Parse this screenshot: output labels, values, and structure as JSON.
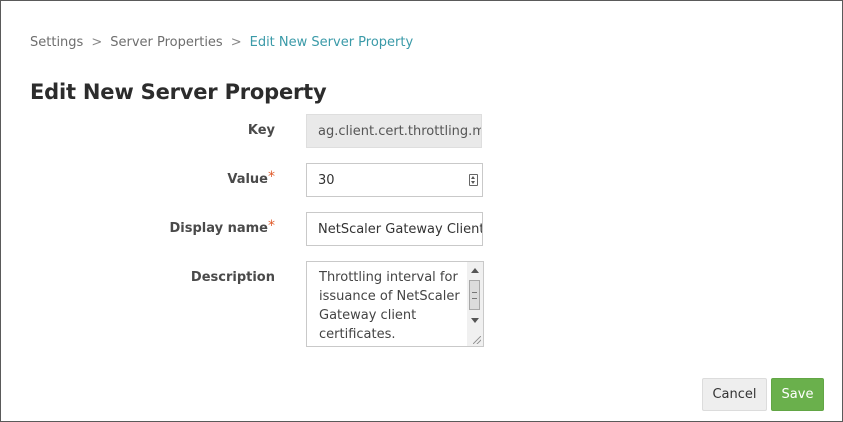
{
  "breadcrumb": {
    "items": [
      "Settings",
      "Server Properties",
      "Edit New Server Property"
    ],
    "separator": ">"
  },
  "page_title": "Edit New Server Property",
  "form": {
    "key": {
      "label": "Key",
      "value": "ag.client.cert.throttling.mi",
      "readonly": true
    },
    "value": {
      "label": "Value",
      "required_marker": "*",
      "value": "30"
    },
    "display_name": {
      "label": "Display name",
      "required_marker": "*",
      "value": "NetScaler Gateway Client"
    },
    "description": {
      "label": "Description",
      "value": "Throttling interval for issuance of NetScaler Gateway client certificates."
    }
  },
  "buttons": {
    "cancel": "Cancel",
    "save": "Save"
  },
  "colors": {
    "accent_link": "#3a9aa8",
    "required": "#e05a2a",
    "save_button": "#6ab04c",
    "readonly_field": "#e9e9e9"
  },
  "icons": {
    "value_spinner": "spinner-icon",
    "scroll_up": "scroll-up-arrow-icon",
    "scroll_down": "scroll-down-arrow-icon",
    "resize": "resize-grip-icon"
  }
}
